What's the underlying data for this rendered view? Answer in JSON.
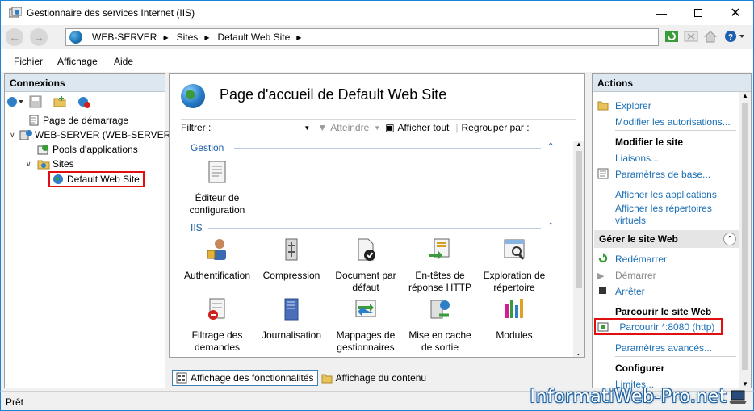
{
  "window": {
    "title": "Gestionnaire des services Internet (IIS)"
  },
  "address": {
    "crumbs": [
      "WEB-SERVER",
      "Sites",
      "Default Web Site"
    ]
  },
  "menu": {
    "items": [
      "Fichier",
      "Affichage",
      "Aide"
    ]
  },
  "connections": {
    "header": "Connexions",
    "tree": {
      "start_page": "Page de démarrage",
      "server": "WEB-SERVER (WEB-SERVER\\A",
      "app_pools": "Pools d'applications",
      "sites": "Sites",
      "default_site": "Default Web Site"
    }
  },
  "center": {
    "title": "Page d'accueil de Default Web Site",
    "filter_label": "Filtrer :",
    "go_label": "Atteindre",
    "show_all_label": "Afficher tout",
    "group_by_label": "Regrouper par :",
    "sections": {
      "gestion": "Gestion",
      "iis": "IIS"
    },
    "features": {
      "config_editor": "Éditeur de configuration",
      "auth": "Authentification",
      "compression": "Compression",
      "default_doc": "Document par défaut",
      "http_headers": "En-têtes de réponse HTTP",
      "dir_browsing": "Exploration de répertoire",
      "request_filtering": "Filtrage des demandes",
      "logging": "Journalisation",
      "handler_mappings": "Mappages de gestionnaires",
      "output_caching": "Mise en cache de sortie",
      "modules": "Modules"
    },
    "views": {
      "features_view": "Affichage des fonctionnalités",
      "content_view": "Affichage du contenu"
    }
  },
  "actions": {
    "header": "Actions",
    "explore": "Explorer",
    "edit_permissions": "Modifier les autorisations...",
    "edit_site_header": "Modifier le site",
    "bindings": "Liaisons...",
    "basic_settings": "Paramètres de base...",
    "view_apps": "Afficher les applications",
    "view_vdirs": "Afficher les répertoires virtuels",
    "manage_site_header": "Gérer le site Web",
    "restart": "Redémarrer",
    "start": "Démarrer",
    "stop": "Arrêter",
    "browse_header": "Parcourir le site Web",
    "browse_link": "Parcourir *:8080 (http)",
    "advanced": "Paramètres avancés...",
    "configure_header": "Configurer",
    "limits": "Limites..."
  },
  "status": {
    "text": "Prêt"
  },
  "watermark": {
    "text": "InformatiWeb-Pro.net"
  }
}
